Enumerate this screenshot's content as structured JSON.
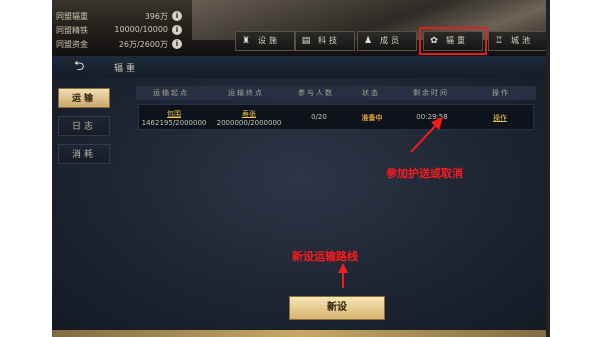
{
  "resources": [
    {
      "label": "同盟辐重",
      "value": "396万"
    },
    {
      "label": "同盟精铁",
      "value": "10000/10000"
    },
    {
      "label": "同盟资金",
      "value": "26万/2600万"
    }
  ],
  "nav": [
    {
      "label": "设施",
      "icon": "tower-icon"
    },
    {
      "label": "科技",
      "icon": "book-icon"
    },
    {
      "label": "成员",
      "icon": "members-icon"
    },
    {
      "label": "辐重",
      "icon": "cart-icon"
    },
    {
      "label": "城池",
      "icon": "castle-icon"
    }
  ],
  "subheader": {
    "title": "辐重"
  },
  "sidebar": [
    {
      "label": "运输",
      "active": true
    },
    {
      "label": "日志",
      "active": false
    },
    {
      "label": "消耗",
      "active": false
    }
  ],
  "table": {
    "headers": [
      "运输起点",
      "运输终点",
      "参与人数",
      "状态",
      "剩余时间",
      "操作"
    ],
    "row": {
      "origin_name": "包围",
      "origin_amount": "1462195/2000000",
      "dest_name": "寿张",
      "dest_amount": "2000000/2000000",
      "participants": "0/20",
      "status": "准备中",
      "time_left": "00:29:58",
      "action": "操作"
    }
  },
  "annotations": {
    "cancel_note": "参加护送或取消",
    "new_route_note": "新设运输路线"
  },
  "new_button": "新设",
  "colors": {
    "annotation": "#ff1a1a",
    "gold": "#e8a43c",
    "link": "#f0c94a"
  }
}
